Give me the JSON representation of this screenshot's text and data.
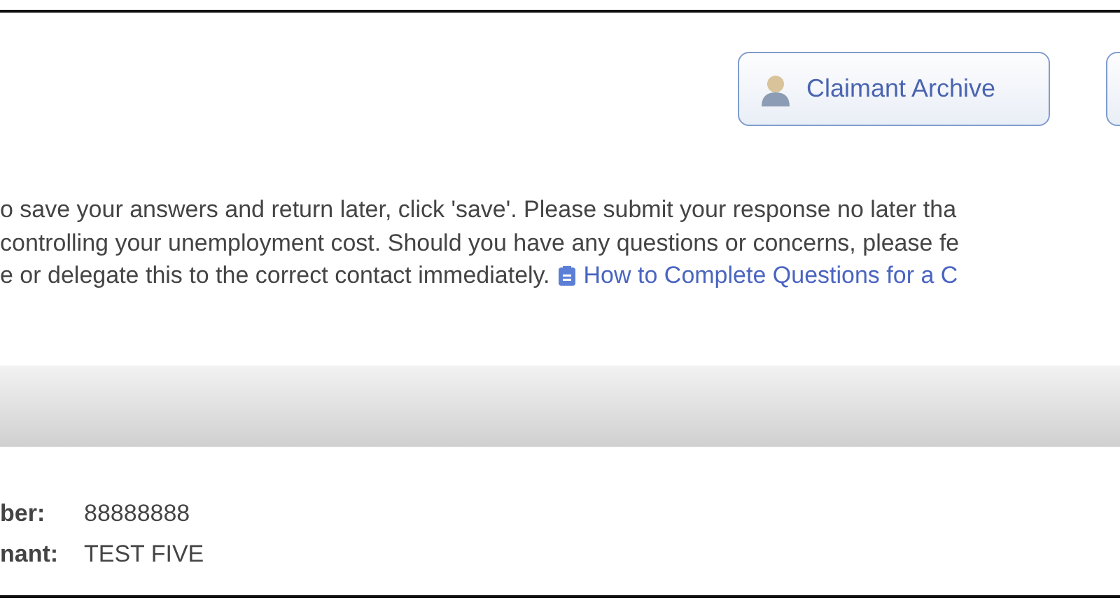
{
  "toolbar": {
    "buttons": [
      {
        "kind": "icon-label",
        "label": "Claimant Archive"
      },
      {
        "kind": "cut-off"
      }
    ]
  },
  "instructions": {
    "lines": [
      "o save your answers and return later, click 'save'. Please submit your response no later tha",
      "controlling your unemployment cost. Should you have any questions or concerns, please fe",
      "e or delegate this to the correct contact immediately."
    ],
    "link": "How to Complete Questions for a C"
  },
  "fields": [
    {
      "label": "ber:",
      "value": "88888888"
    },
    {
      "label": "nant:",
      "value": "TEST FIVE"
    }
  ]
}
